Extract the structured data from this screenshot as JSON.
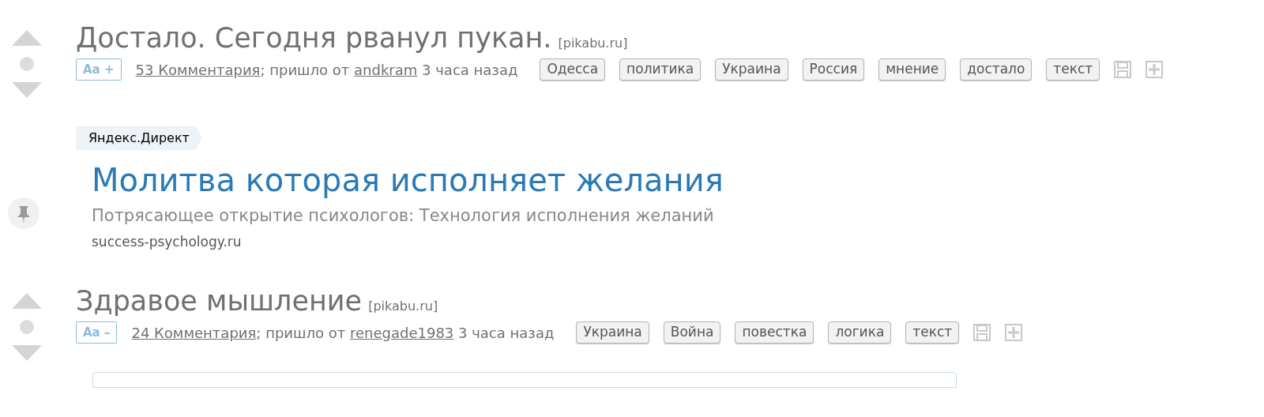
{
  "feed": [
    {
      "kind": "post",
      "title": "Достало. Сегодня рванул пукан.",
      "source": "[pikabu.ru]",
      "font_button": "Aa +",
      "comments": "53 Комментария",
      "from_text": "; пришло от",
      "author": "andkram",
      "time": "3 часа назад",
      "tags": [
        "Одесса",
        "политика",
        "Украина",
        "Россия",
        "мнение",
        "достало",
        "текст"
      ]
    },
    {
      "kind": "ad",
      "label": "Яндекс.Директ",
      "title": "Молитва которая исполняет желания",
      "description": "Потрясающее открытие психологов: Технология исполнения желаний",
      "url": "success-psychology.ru"
    },
    {
      "kind": "post",
      "title": "Здравое мышление",
      "source": "[pikabu.ru]",
      "font_button": "Aa –",
      "comments": "24 Комментария",
      "from_text": "; пришло от",
      "author": "renegade1983",
      "time": "3 часа назад",
      "tags": [
        "Украина",
        "Война",
        "повестка",
        "логика",
        "текст"
      ]
    }
  ]
}
